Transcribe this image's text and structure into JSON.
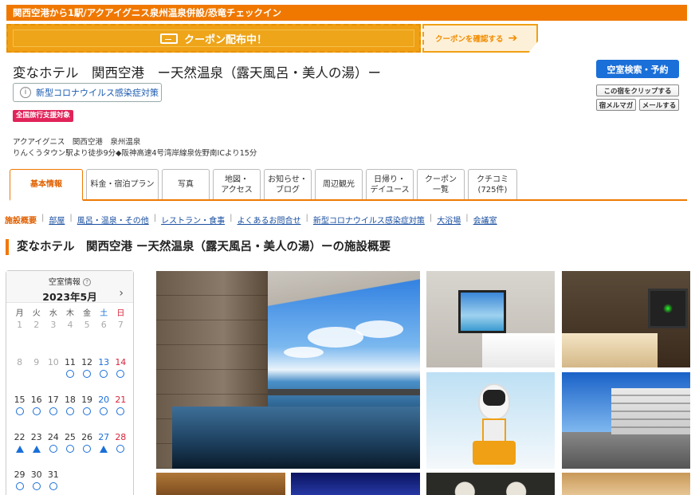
{
  "banner": {
    "text": "関西空港から1駅/アクアイグニス泉州温泉併設/恐竜チェックイン"
  },
  "coupon": {
    "label": "クーポン配布中！",
    "link": "クーポンを確認する",
    "arrow": "➔"
  },
  "hotel": {
    "name": "変なホテル　関西空港　ー天然温泉（露天風呂・美人の湯）ー",
    "covid_button": "新型コロナウイルス感染症対策",
    "info_icon": "ⓘ",
    "travel_badge": "全国旅行支援対象",
    "address_line1": "アクアイグニス　関西空港　泉州温泉",
    "address_line2": "りんくうタウン駅より徒歩9分◆阪神高速4号湾岸線泉佐野南ICより15分"
  },
  "actions": {
    "search": "空室検索・予約",
    "clip": "この宿をクリップする",
    "magazine": "宿メルマガ",
    "mail": "メールする"
  },
  "tabs": [
    {
      "label": "基本情報"
    },
    {
      "label": "料金・宿泊プラン"
    },
    {
      "label": "写真"
    },
    {
      "label": "地図・\nアクセス"
    },
    {
      "label": "お知らせ・\nブログ"
    },
    {
      "label": "周辺観光"
    },
    {
      "label": "日帰り・\nデイユース"
    },
    {
      "label": "クーポン\n一覧"
    },
    {
      "label": "クチコミ\n(725件)"
    }
  ],
  "subnav": [
    {
      "label": "施設概要",
      "current": true
    },
    {
      "label": "部屋"
    },
    {
      "label": "風呂・温泉・その他"
    },
    {
      "label": "レストラン・食事"
    },
    {
      "label": "よくあるお問合せ"
    },
    {
      "label": "新型コロナウイルス感染症対策"
    },
    {
      "label": "大浴場"
    },
    {
      "label": "会議室"
    }
  ],
  "subnav_sep": "|",
  "section_title": "変なホテル　関西空港 ー天然温泉（露天風呂・美人の湯）ーの施設概要",
  "calendar": {
    "label": "空室情報",
    "help_icon": "?",
    "month": "2023年5月",
    "next": "›",
    "weekdays": [
      "月",
      "火",
      "水",
      "木",
      "金",
      "土",
      "日"
    ],
    "rows": [
      [
        [
          "1",
          ""
        ],
        [
          "2",
          ""
        ],
        [
          "3",
          ""
        ],
        [
          "4",
          ""
        ],
        [
          "5",
          ""
        ],
        [
          "6",
          ""
        ],
        [
          "7",
          ""
        ]
      ],
      [
        [
          "8",
          ""
        ],
        [
          "9",
          ""
        ],
        [
          "10",
          ""
        ],
        [
          "11",
          "○"
        ],
        [
          "12",
          "○"
        ],
        [
          "13",
          "○"
        ],
        [
          "14",
          "○"
        ]
      ],
      [
        [
          "15",
          "○"
        ],
        [
          "16",
          "○"
        ],
        [
          "17",
          "○"
        ],
        [
          "18",
          "○"
        ],
        [
          "19",
          "○"
        ],
        [
          "20",
          "○"
        ],
        [
          "21",
          "○"
        ]
      ],
      [
        [
          "22",
          "△"
        ],
        [
          "23",
          "△"
        ],
        [
          "24",
          "○"
        ],
        [
          "25",
          "○"
        ],
        [
          "26",
          "○"
        ],
        [
          "27",
          "△"
        ],
        [
          "28",
          "○"
        ]
      ],
      [
        [
          "29",
          "○"
        ],
        [
          "30",
          "○"
        ],
        [
          "31",
          "○"
        ]
      ]
    ],
    "dim_through": 10
  }
}
